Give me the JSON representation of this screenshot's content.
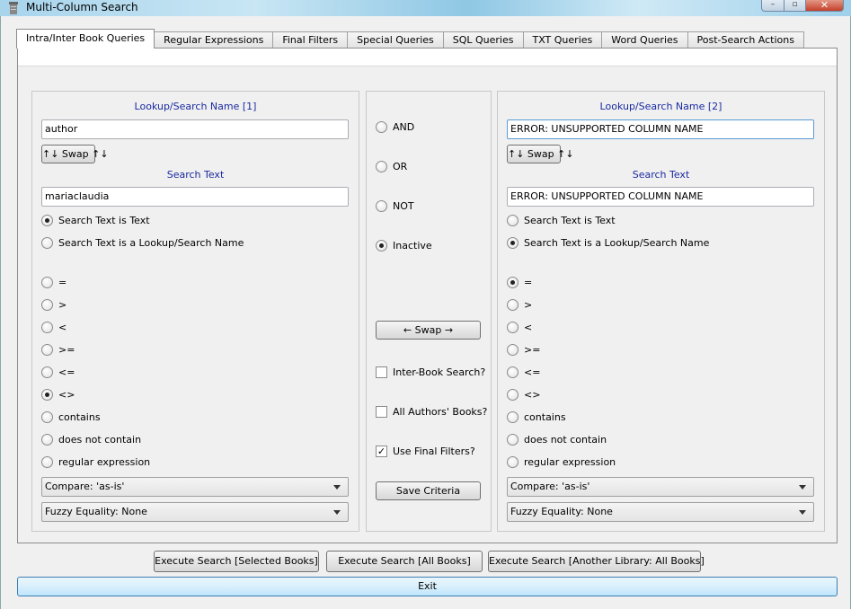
{
  "window": {
    "title": "Multi-Column Search",
    "controls": {
      "minimize": "–",
      "maximize": "▫",
      "close": "✕"
    }
  },
  "tabs": [
    {
      "label": "Intra/Inter Book Queries",
      "active": true
    },
    {
      "label": "Regular Expressions"
    },
    {
      "label": "Final Filters"
    },
    {
      "label": "Special Queries"
    },
    {
      "label": "SQL Queries"
    },
    {
      "label": "TXT Queries"
    },
    {
      "label": "Word Queries"
    },
    {
      "label": "Post-Search Actions"
    }
  ],
  "left": {
    "lookup_heading": "Lookup/Search Name [1]",
    "lookup_value": "author",
    "swap_label": "↑↓ Swap ↑↓",
    "search_heading": "Search Text",
    "search_value": "mariaclaudia",
    "mode_options": [
      "Search Text is Text",
      "Search Text is a Lookup/Search Name"
    ],
    "mode_selected": 0,
    "operators": [
      "=",
      ">",
      "<",
      ">=",
      "<=",
      "<>",
      "contains",
      "does not contain",
      "regular expression"
    ],
    "operator_selected": 5,
    "compare": "Compare: 'as-is'",
    "fuzzy": "Fuzzy Equality: None"
  },
  "middle": {
    "logic": [
      "AND",
      "OR",
      "NOT",
      "Inactive"
    ],
    "logic_selected": 3,
    "swap_label": "← Swap →",
    "checks": [
      {
        "label": "Inter-Book Search?",
        "checked": false
      },
      {
        "label": "All Authors' Books?",
        "checked": false
      },
      {
        "label": "Use Final Filters?",
        "checked": true
      }
    ],
    "save_label": "Save Criteria"
  },
  "right": {
    "lookup_heading": "Lookup/Search Name [2]",
    "lookup_value": "ERROR: UNSUPPORTED COLUMN NAME",
    "swap_label": "↑↓ Swap ↑↓",
    "search_heading": "Search Text",
    "search_value": "ERROR: UNSUPPORTED COLUMN NAME",
    "mode_options": [
      "Search Text is Text",
      "Search Text is a Lookup/Search Name"
    ],
    "mode_selected": 1,
    "operators": [
      "=",
      ">",
      "<",
      ">=",
      "<=",
      "<>",
      "contains",
      "does not contain",
      "regular expression"
    ],
    "operator_selected": 0,
    "compare": "Compare: 'as-is'",
    "fuzzy": "Fuzzy Equality: None"
  },
  "footer": {
    "exec_selected": "Execute Search [Selected Books]",
    "exec_all": "Execute Search [All Books]",
    "exec_other": "Execute Search [Another Library: All Books]",
    "exit": "Exit"
  }
}
